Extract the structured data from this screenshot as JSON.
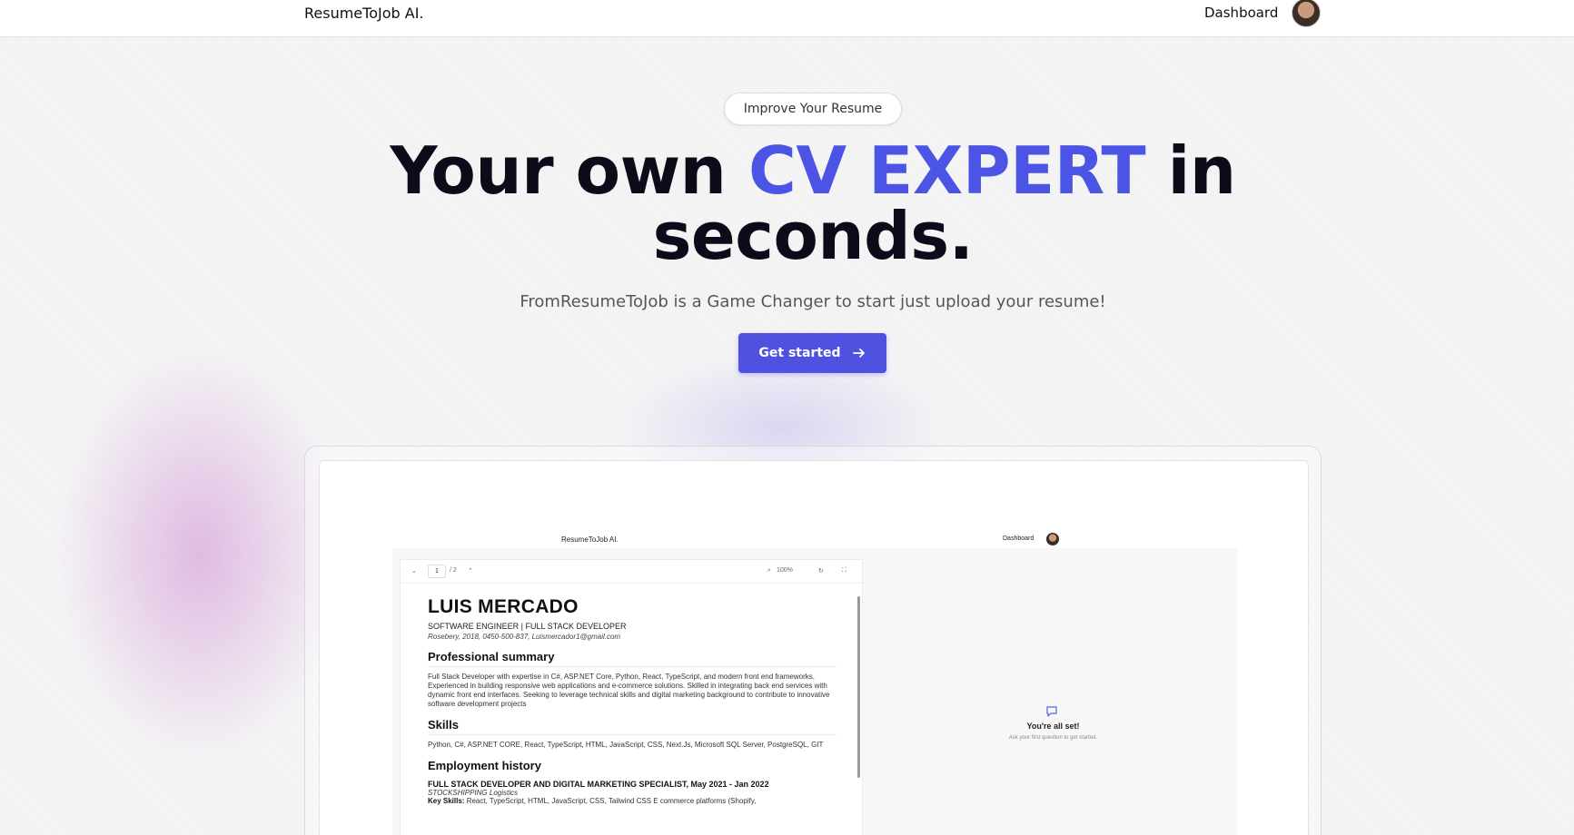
{
  "nav": {
    "brand": "ResumeToJob AI.",
    "dashboard_link": "Dashboard"
  },
  "hero": {
    "badge": "Improve Your Resume",
    "title_part1": "Your own ",
    "title_accent": "CV EXPERT",
    "title_part2": " in",
    "title_line2": "seconds.",
    "subtitle": "FromResumeToJob is a Game Changer to start just upload your resume!",
    "cta_label": "Get started"
  },
  "preview": {
    "nav": {
      "brand": "ResumeToJob AI.",
      "dashboard_link": "Dashboard"
    },
    "pdf_toolbar": {
      "page_current": "1",
      "page_total": "/ 2",
      "zoom": "100%"
    },
    "resume": {
      "name": "LUIS MERCADO",
      "role": "SOFTWARE ENGINEER | FULL STACK DEVELOPER",
      "contact": "Rosebery, 2018, 0450-500-837, Luismercador1@gmail.com",
      "summary_heading": "Professional summary",
      "summary_text": "Full Stack Developer with expertise in C#, ASP.NET Core, Python, React, TypeScript, and modern front end frameworks. Experienced in building responsive web applications and e-commerce solutions. Skilled in integrating back end services with dynamic front end interfaces. Seeking to leverage technical skills and digital marketing background to contribute to innovative software development projects",
      "skills_heading": "Skills",
      "skills_text": "Python, C#, ASP.NET CORE, React, TypeScript, HTML, JavaScript, CSS, Next.Js, Microsoft SQL Server, PostgreSQL, GIT",
      "employment_heading": "Employment history",
      "job_title": "FULL STACK DEVELOPER AND DIGITAL MARKETING SPECIALIST, May 2021 - Jan 2022",
      "job_company": "STOCKSHIPPING Logistics",
      "job_key_skills_label": "Key Skills:",
      "job_key_skills": "React, TypeScript, HTML, JavaScript, CSS, Tailwind CSS E commerce platforms (Shopify,"
    },
    "chat": {
      "title": "You're all set!",
      "subtitle": "Ask your first question to get started."
    }
  },
  "colors": {
    "accent": "#4c54e6",
    "cta_background": "#4f52e0"
  }
}
